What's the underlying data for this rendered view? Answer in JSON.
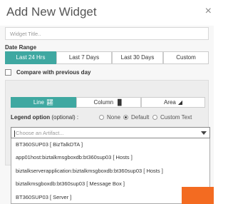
{
  "dialog": {
    "title": "Add New Widget",
    "close_glyph": "×"
  },
  "form": {
    "widget_title_placeholder": "Widget Title..",
    "date_range_label": "Date Range",
    "date_ranges": [
      "Last 24 Hrs",
      "Last 7 Days",
      "Last 30 Days",
      "Custom"
    ],
    "date_range_selected": "Last 24 Hrs",
    "compare_label": "Compare with previous day",
    "compare_checked": false
  },
  "chart_types": [
    {
      "label": "Line",
      "icon": "line-chart-icon",
      "active": true
    },
    {
      "label": "Column",
      "icon": "column-chart-icon",
      "active": false
    },
    {
      "label": "Area",
      "icon": "area-chart-icon",
      "active": false
    }
  ],
  "legend": {
    "label_bold": "Legend option",
    "label_rest": "(optional) :",
    "options": [
      "None",
      "Default",
      "Custom Text"
    ],
    "selected": "Default"
  },
  "artifact_select": {
    "placeholder": "Choose an Artifact...",
    "options": [
      "BT360SUP03 [ BizTalkDTA ]",
      "app01host:biztalkmsgboxdb:bt360sup03 [ Hosts ]",
      "biztalkserverapplication:biztalkmsgboxdb:bt360sup03 [ Hosts ]",
      "biztalkmsgboxdb:bt360sup03 [ Message Box ]",
      "BT360SUP03 [ Server ]"
    ]
  },
  "colors": {
    "accent": "#3fa8a1",
    "action": "#f36b21"
  }
}
